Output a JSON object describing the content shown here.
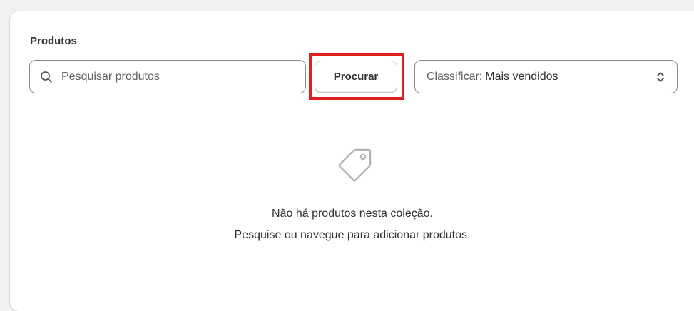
{
  "products_section": {
    "title": "Produtos",
    "search": {
      "placeholder": "Pesquisar produtos",
      "value": "",
      "icon": "search-icon"
    },
    "search_button_label": "Procurar",
    "sort": {
      "prefix": "Classificar:",
      "value": "Mais vendidos",
      "icon": "chevron-up-down-icon"
    },
    "empty_state": {
      "icon": "tag-icon",
      "line1": "Não há produtos nesta coleção.",
      "line2": "Pesquise ou navegue para adicionar produtos."
    }
  },
  "colors": {
    "highlight": "#e02020",
    "text": "#303030",
    "muted_text": "#616161",
    "border": "#8a8a8a"
  }
}
